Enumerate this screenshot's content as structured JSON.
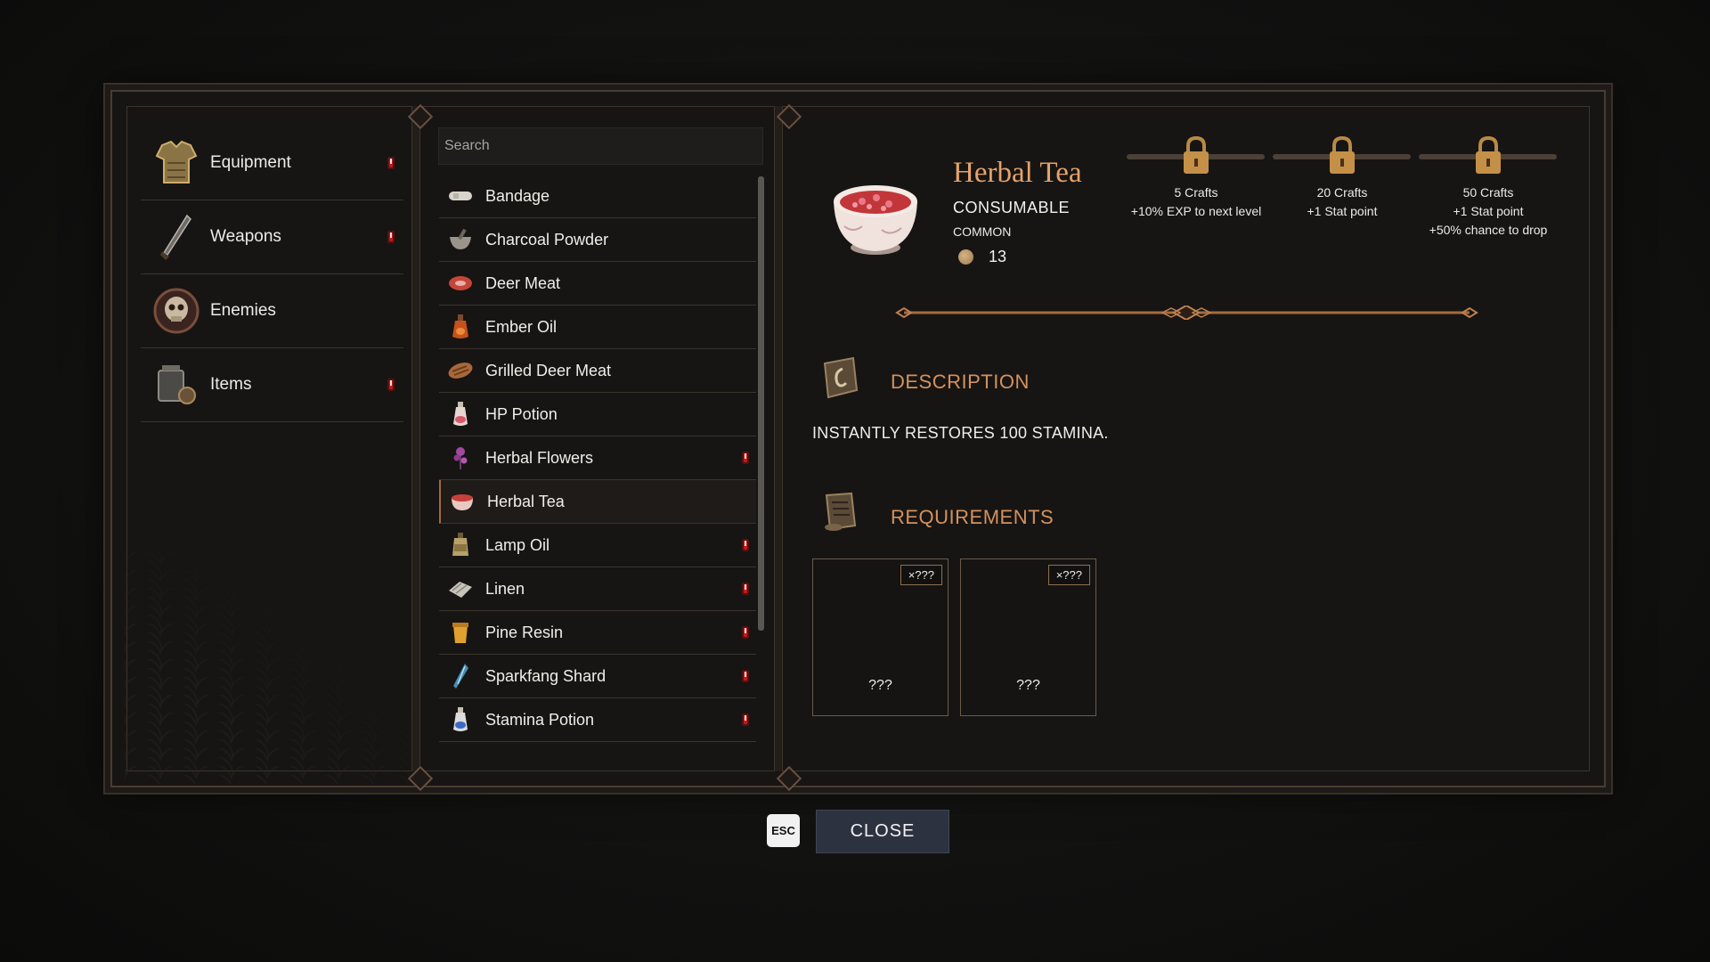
{
  "categories": [
    {
      "label": "Equipment",
      "icon": "armor-icon",
      "alert": true
    },
    {
      "label": "Weapons",
      "icon": "sword-icon",
      "alert": true
    },
    {
      "label": "Enemies",
      "icon": "skull-icon",
      "alert": false
    },
    {
      "label": "Items",
      "icon": "items-icon",
      "alert": true
    }
  ],
  "search": {
    "placeholder": "Search"
  },
  "items": [
    {
      "label": "Bandage",
      "alert": false
    },
    {
      "label": "Charcoal Powder",
      "alert": false
    },
    {
      "label": "Deer Meat",
      "alert": false
    },
    {
      "label": "Ember Oil",
      "alert": false
    },
    {
      "label": "Grilled Deer Meat",
      "alert": false
    },
    {
      "label": "HP Potion",
      "alert": false
    },
    {
      "label": "Herbal Flowers",
      "alert": true
    },
    {
      "label": "Herbal Tea",
      "alert": false,
      "selected": true
    },
    {
      "label": "Lamp Oil",
      "alert": true
    },
    {
      "label": "Linen",
      "alert": true
    },
    {
      "label": "Pine Resin",
      "alert": true
    },
    {
      "label": "Sparkfang Shard",
      "alert": true
    },
    {
      "label": "Stamina Potion",
      "alert": true
    }
  ],
  "detail": {
    "title": "Herbal Tea",
    "type": "CONSUMABLE",
    "rarity": "COMMON",
    "price": "13",
    "milestones": [
      {
        "crafts": "5 Crafts",
        "rewards": [
          "+10% EXP to next level"
        ],
        "locked": true
      },
      {
        "crafts": "20 Crafts",
        "rewards": [
          "+1 Stat point"
        ],
        "locked": true
      },
      {
        "crafts": "50 Crafts",
        "rewards": [
          "+1 Stat point",
          "+50% chance to drop"
        ],
        "locked": true
      }
    ],
    "description_title": "DESCRIPTION",
    "description": "INSTANTLY RESTORES 100 STAMINA.",
    "requirements_title": "REQUIREMENTS",
    "requirements": [
      {
        "qty": "×???",
        "name": "???"
      },
      {
        "qty": "×???",
        "name": "???"
      }
    ]
  },
  "footer": {
    "esc": "ESC",
    "close": "CLOSE"
  },
  "colors": {
    "accent": "#e5a36a",
    "section": "#d5915c",
    "alert": "#b81e1e",
    "close_bg": "#2d3240"
  }
}
